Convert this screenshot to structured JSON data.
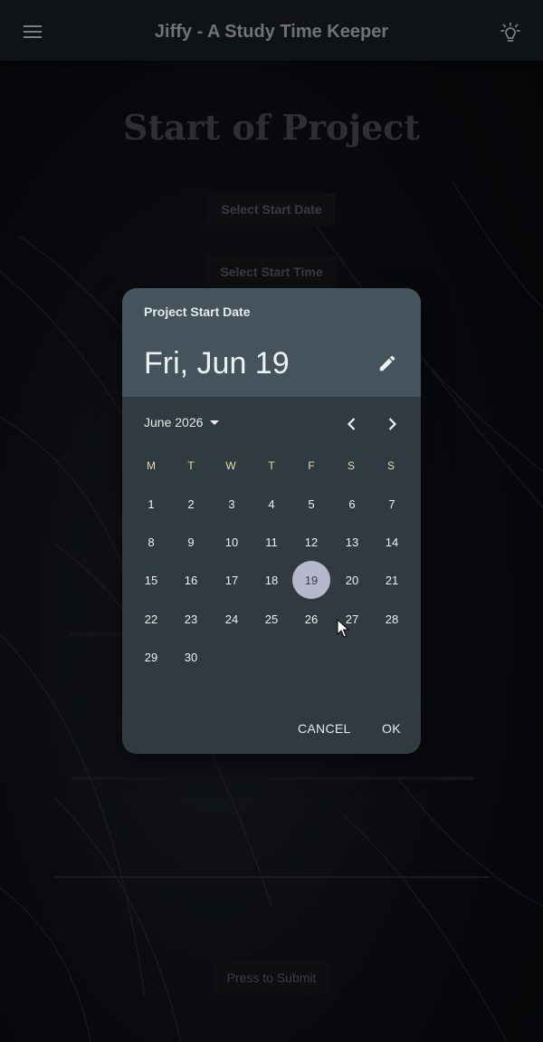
{
  "app_bar": {
    "title": "Jiffy - A Study Time Keeper",
    "menu_icon": "hamburger-menu-icon",
    "theme_icon": "lightbulb-icon"
  },
  "page": {
    "title": "Start of Project",
    "select_date_label": "Select Start Date",
    "select_time_label": "Select Start Time",
    "submit_label": "Press to Submit"
  },
  "date_picker": {
    "label": "Project Start Date",
    "selected_date_text": "Fri, Jun 19",
    "edit_icon": "pencil-icon",
    "month_year": "June 2026",
    "weekdays": [
      "M",
      "T",
      "W",
      "T",
      "F",
      "S",
      "S"
    ],
    "days": [
      "1",
      "2",
      "3",
      "4",
      "5",
      "6",
      "7",
      "8",
      "9",
      "10",
      "11",
      "12",
      "13",
      "14",
      "15",
      "16",
      "17",
      "18",
      "19",
      "20",
      "21",
      "22",
      "23",
      "24",
      "25",
      "26",
      "27",
      "28",
      "29",
      "30"
    ],
    "selected_day": "19",
    "cancel_label": "CANCEL",
    "ok_label": "OK"
  },
  "colors": {
    "dialog_bg": "#2f3a41",
    "dialog_header": "#44535c",
    "weekday": "#e6dfa8",
    "selected_day_bg": "#b4b8ca"
  }
}
